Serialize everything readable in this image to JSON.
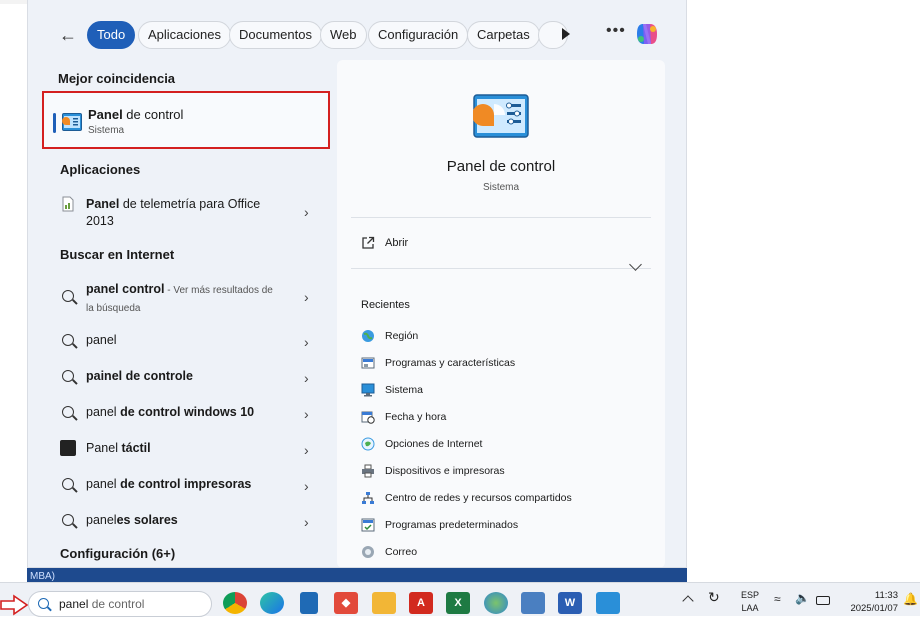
{
  "filters": {
    "tabs": [
      {
        "label": "Todo",
        "active": true
      },
      {
        "label": "Aplicaciones"
      },
      {
        "label": "Documentos"
      },
      {
        "label": "Web"
      },
      {
        "label": "Configuración"
      },
      {
        "label": "Carpetas"
      }
    ],
    "more_icon": "play-icon",
    "overflow_icon": "more-dots-icon"
  },
  "sections": {
    "best_match": "Mejor coincidencia",
    "apps": "Aplicaciones",
    "web": "Buscar en Internet",
    "settings": "Configuración (6+)"
  },
  "best_match": {
    "title_bold": "Panel",
    "title_rest": " de control",
    "subtitle": "Sistema"
  },
  "apps": [
    {
      "bold": "Panel",
      "rest": " de telemetría para Office",
      "line2": "2013"
    }
  ],
  "web_results": [
    {
      "bold": "panel control",
      "rest": "",
      "hint": " - Ver más resultados de",
      "hint2": "la búsqueda"
    },
    {
      "pre": "panel",
      "bold": "",
      "rest": ""
    },
    {
      "pre": "",
      "bold": "painel de controle",
      "rest": ""
    },
    {
      "pre": "panel ",
      "bold": "de control windows 10",
      "rest": ""
    },
    {
      "pre": "Panel ",
      "bold": "táctil",
      "rest": ""
    },
    {
      "pre": "panel ",
      "bold": "de control impresoras",
      "rest": ""
    },
    {
      "pre": "panel",
      "bold": "es solares",
      "rest": ""
    }
  ],
  "detail": {
    "title": "Panel de control",
    "subtitle": "Sistema",
    "open": "Abrir",
    "recent_title": "Recientes",
    "recent": [
      "Región",
      "Programas y características",
      "Sistema",
      "Fecha y hora",
      "Opciones de Internet",
      "Dispositivos e impresoras",
      "Centro de redes y recursos compartidos",
      "Programas predeterminados",
      "Correo"
    ]
  },
  "backdrop_text": "MBA)",
  "taskbar": {
    "search_typed": "panel",
    "search_ghost": " de control",
    "lang_1": "ESP",
    "lang_2": "LAA",
    "time": "11:33",
    "date": "2025/01/07"
  },
  "colors": {
    "accent": "#1f5fb8",
    "highlight_border": "#d42020",
    "taskbar_blue": "#1e4a8e"
  }
}
